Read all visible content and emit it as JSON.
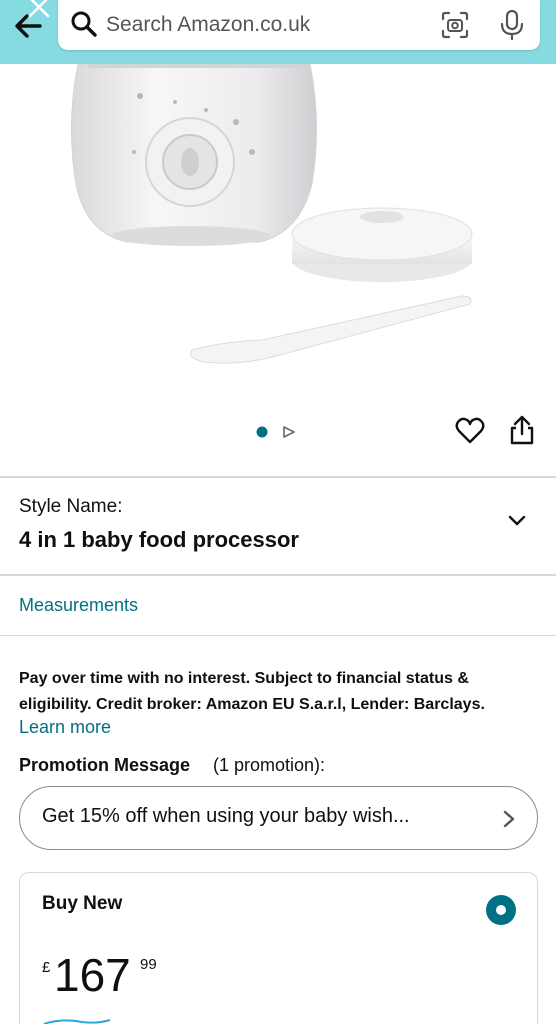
{
  "header": {
    "search_placeholder": "Search Amazon.co.uk",
    "back_icon": "arrow-left-icon",
    "lens_icon": "camera-lens-icon",
    "mic_icon": "microphone-icon",
    "bar_color": "#86dbe0"
  },
  "carousel": {
    "dots": 2,
    "active_index": 0,
    "second_is_video": true
  },
  "style": {
    "label": "Style Name:",
    "value": "4 in 1 baby food processor"
  },
  "measurements_link": "Measurements",
  "finance": {
    "text": "Pay over time with no interest. Subject to financial status & eligibility. Credit broker: Amazon EU S.a.r.l, Lender: Barclays.",
    "learn_more": "Learn more"
  },
  "promotion": {
    "title": "Promotion Message",
    "count": "(1 promotion):",
    "message": "Get 15% off when using your baby wish..."
  },
  "buy_new": {
    "title": "Buy New",
    "currency": "£",
    "price_whole": "167",
    "price_fraction": "99",
    "selected": true
  },
  "colors": {
    "link": "#007185",
    "accent": "#007185",
    "text": "#0f1111"
  }
}
